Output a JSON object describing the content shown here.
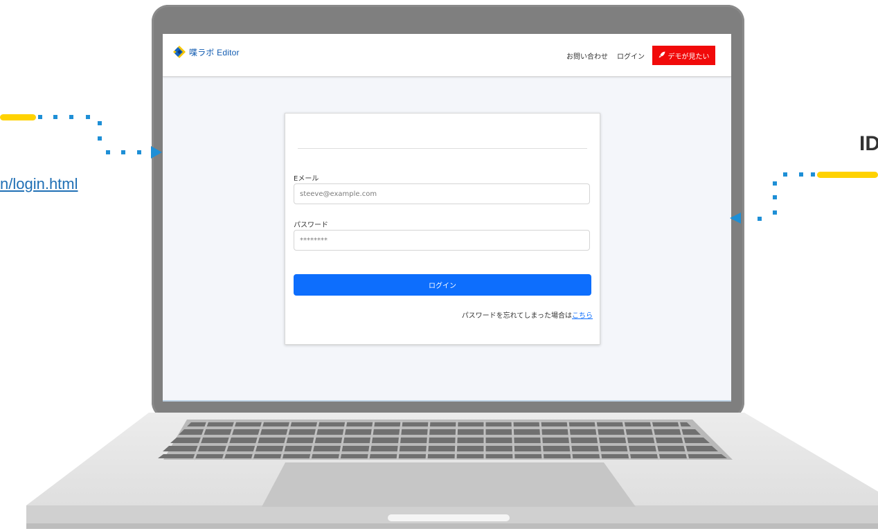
{
  "app": {
    "brand": "喋ラボ Editor"
  },
  "nav": {
    "contact": "お問い合わせ",
    "login": "ログイン",
    "demo": "デモが見たい"
  },
  "form": {
    "email_label": "Eメール",
    "email_placeholder": "steeve@example.com",
    "password_label": "パスワード",
    "password_placeholder": "********",
    "submit": "ログイン",
    "forgot_prefix": "パスワードを忘れてしまった場合は",
    "forgot_link": "こちら"
  },
  "annotations": {
    "url": "n/login.html",
    "id": "ID"
  },
  "colors": {
    "primary": "#0d6efd",
    "demo": "#f10a0a",
    "brand": "#0f5ab0",
    "accent_yellow": "#ffd200",
    "arrow_blue": "#1e8fd6"
  },
  "icons": {
    "brand": "brand-logo-icon",
    "rocket": "rocket-icon"
  }
}
